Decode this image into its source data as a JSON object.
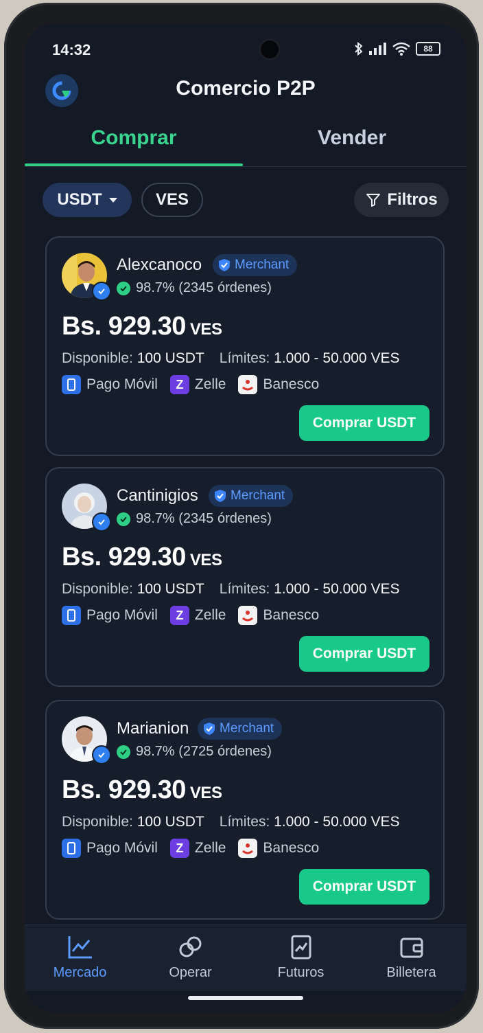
{
  "status_bar": {
    "time": "14:32",
    "battery": "88"
  },
  "header": {
    "title": "Comercio P2P"
  },
  "tabs": {
    "buy": "Comprar",
    "sell": "Vender"
  },
  "filters": {
    "asset": "USDT",
    "fiat": "VES",
    "filter_label": "Filtros"
  },
  "labels": {
    "available": "Disponible:",
    "limits": "Límites:",
    "merchant": "Merchant"
  },
  "listings": [
    {
      "seller": "Alexcanoco",
      "rating": "98.7% (2345 órdenes)",
      "price": "Bs. 929.30",
      "currency": "VES",
      "available": "100 USDT",
      "limits": "1.000 - 50.000 VES",
      "methods": [
        "Pago Móvil",
        "Zelle",
        "Banesco"
      ],
      "button": "Comprar USDT"
    },
    {
      "seller": "Cantinigios",
      "rating": "98.7% (2345 órdenes)",
      "price": "Bs. 929.30",
      "currency": "VES",
      "available": "100 USDT",
      "limits": "1.000 - 50.000 VES",
      "methods": [
        "Pago Móvil",
        "Zelle",
        "Banesco"
      ],
      "button": "Comprar USDT"
    },
    {
      "seller": "Marianion",
      "rating": "98.7% (2725 órdenes)",
      "price": "Bs. 929.30",
      "currency": "VES",
      "available": "100 USDT",
      "limits": "1.000 - 50.000 VES",
      "methods": [
        "Pago Móvil",
        "Zelle",
        "Banesco"
      ],
      "button": "Comprar USDT"
    }
  ],
  "bottom_nav": [
    {
      "label": "Mercado",
      "icon": "chart-line-icon",
      "active": true
    },
    {
      "label": "Operar",
      "icon": "exchange-icon",
      "active": false
    },
    {
      "label": "Futuros",
      "icon": "futures-icon",
      "active": false
    },
    {
      "label": "Billetera",
      "icon": "wallet-icon",
      "active": false
    }
  ],
  "colors": {
    "accent_green": "#2fcf86",
    "accent_blue": "#5c9cff",
    "background": "#131925"
  }
}
